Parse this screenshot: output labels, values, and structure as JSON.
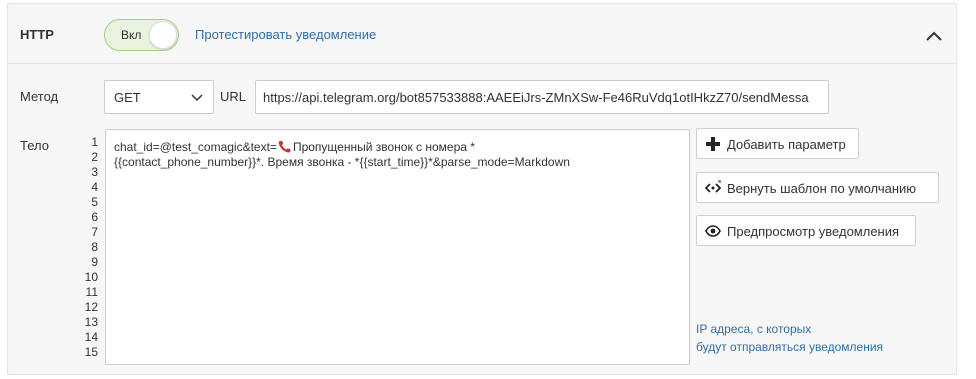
{
  "header": {
    "title": "HTTP",
    "toggle_label": "Вкл",
    "toggle_on": true,
    "test_link": "Протестировать уведомление"
  },
  "method": {
    "label": "Метод",
    "value": "GET"
  },
  "url": {
    "label": "URL",
    "value": "https://api.telegram.org/bot857533888:AAEEiJrs-ZMnXSw-Fe46RuVdq1otIHkzZ70/sendMessa"
  },
  "body": {
    "label": "Тело",
    "line_numbers": [
      "1",
      "2",
      "3",
      "4",
      "5",
      "6",
      "7",
      "8",
      "9",
      "10",
      "11",
      "12",
      "13",
      "14",
      "15"
    ],
    "line1_prefix": "chat_id=@test_comagic&text=",
    "line1_suffix": "Пропущенный звонок с номера *",
    "line2": "{{contact_phone_number}}*. Время звонка - *{{start_time}}*&parse_mode=Markdown"
  },
  "actions": {
    "add_param": "Добавить параметр",
    "reset_template": "Вернуть шаблон по умолчанию",
    "preview": "Предпросмотр уведомления"
  },
  "ip_note": {
    "line1": "IP адреса, с которых",
    "line2": "будут отправляться уведомления"
  },
  "colors": {
    "link": "#2f6ea8",
    "toggle_bg": "#e9f3dd",
    "toggle_border": "#a8cf86"
  },
  "icons": [
    "chevron-up-icon",
    "chevron-down-icon",
    "phone-icon",
    "plus-icon",
    "code-reset-icon",
    "eye-icon"
  ]
}
